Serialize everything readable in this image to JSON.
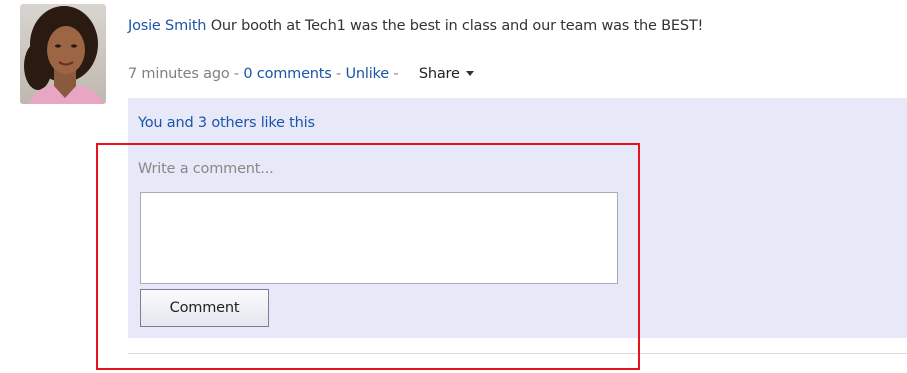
{
  "post": {
    "author": "Josie Smith",
    "text": " Our booth at Tech1 was the best in class and our team was the BEST!",
    "meta": {
      "time": "7 minutes ago",
      "sep1": " - ",
      "comments_link": "0 comments",
      "sep2": " - ",
      "unlike_link": "Unlike",
      "sep3": " - ",
      "share_label": "Share"
    }
  },
  "likes": {
    "text": "You and 3 others like this"
  },
  "comment_form": {
    "label": "Write a comment...",
    "value": "",
    "button_label": "Comment"
  },
  "colors": {
    "link": "#1a55a8",
    "panel_bg": "#e7e8f8",
    "highlight_border": "#e8141c"
  },
  "icons": {
    "share_caret": "chevron-down-icon"
  }
}
